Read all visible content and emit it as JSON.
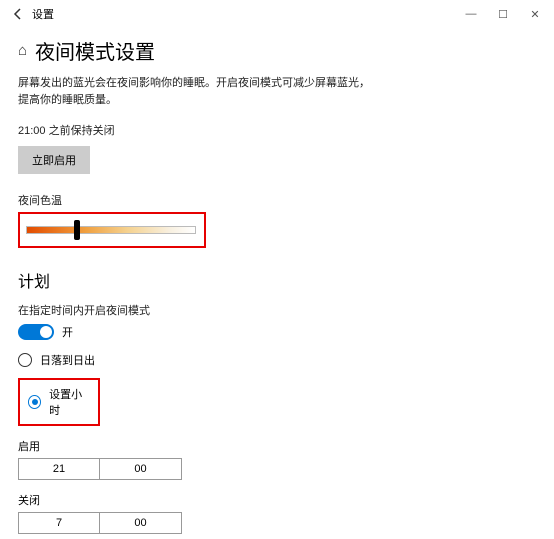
{
  "titlebar": {
    "title": "设置"
  },
  "page": {
    "title": "夜间模式设置",
    "desc_line1": "屏幕发出的蓝光会在夜间影响你的睡眠。开启夜间模式可减少屏幕蓝光，",
    "desc_line2": "提高你的睡眠质量。",
    "status": "21:00 之前保持关闭",
    "enable_now": "立即启用",
    "color_temp_label": "夜间色温",
    "slider_percent": 30
  },
  "schedule": {
    "heading": "计划",
    "toggle_label": "在指定时间内开启夜间模式",
    "toggle_state": "开",
    "radio_sunset": "日落到日出",
    "radio_hours": "设置小时",
    "on_label": "启用",
    "on_hour": "21",
    "on_min": "00",
    "off_label": "关闭",
    "off_hour": "7",
    "off_min": "00"
  }
}
